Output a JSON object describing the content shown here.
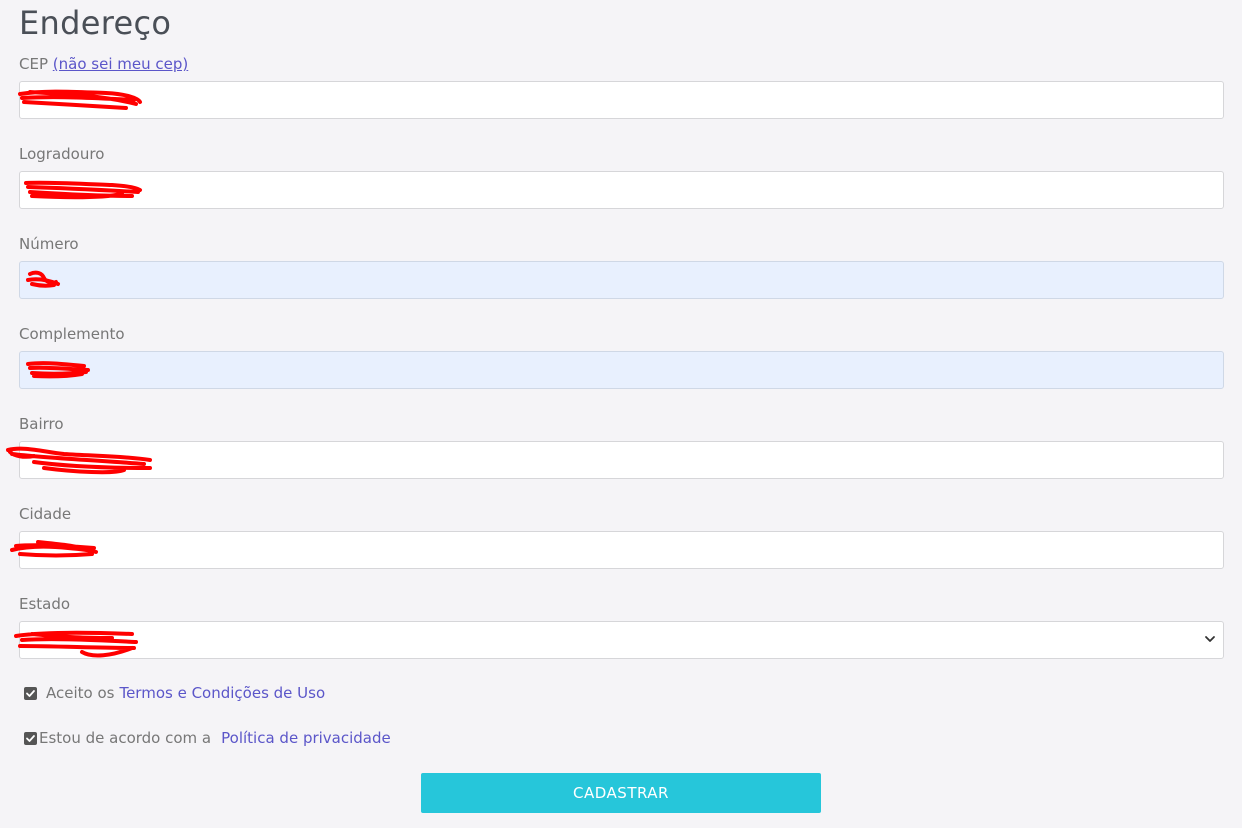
{
  "section": {
    "title": "Endereço"
  },
  "cep": {
    "label": "CEP",
    "help_link": "(não sei meu cep)"
  },
  "logradouro": {
    "label": "Logradouro"
  },
  "numero": {
    "label": "Número"
  },
  "complemento": {
    "label": "Complemento"
  },
  "bairro": {
    "label": "Bairro"
  },
  "cidade": {
    "label": "Cidade"
  },
  "estado": {
    "label": "Estado"
  },
  "terms": {
    "prefix": "Aceito os",
    "link": "Termos e Condições de Uso",
    "checked": true
  },
  "privacy": {
    "prefix": "Estou de acordo com a",
    "link": "Política de privacidade",
    "checked": true
  },
  "submit": {
    "label": "CADASTRAR"
  },
  "colors": {
    "accent": "#26c6da",
    "link": "#5b56c9",
    "redaction": "#ff0000",
    "autofill_bg": "#e8f0fe",
    "page_bg": "#f5f4f7"
  }
}
